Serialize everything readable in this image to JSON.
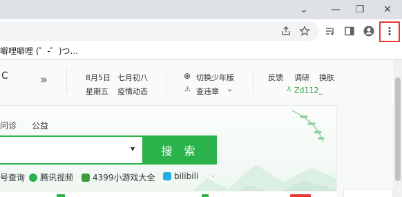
{
  "window": {
    "controls": {
      "chevron": "⌄",
      "minimize": "—",
      "restore": "❐",
      "close": "✕"
    }
  },
  "toolbar": {
    "icons": [
      "share-icon",
      "star-icon",
      "reading-list-icon",
      "side-panel-icon",
      "profile-icon",
      "kebab-menu-icon"
    ],
    "highlight_color": "#e53935"
  },
  "bookmarks": {
    "item": "噼哩噼哩 (゜-゜)つ..."
  },
  "header": {
    "partial_left": "C",
    "chevrons": "»",
    "date": "8月5日",
    "weekday": "星期五",
    "lunar": "七月初八",
    "epidemic": "疫情动态",
    "youth_mode": "切换少年版",
    "violation": "查违章",
    "feedback": "反馈",
    "survey": "调研",
    "skin": "换肤",
    "username": "Zd112_"
  },
  "search": {
    "tabs": [
      "问诊",
      "公益"
    ],
    "button_label": "搜 索",
    "accent": "#2ab34a",
    "quick_links": [
      {
        "label": "号查询",
        "color": "#5b8def"
      },
      {
        "label": "腾讯视频",
        "color": "#2ab34a"
      },
      {
        "label": "4399小游戏大全",
        "color": "#3c9b3c"
      },
      {
        "label": "bilibili",
        "color": "#23ade5"
      }
    ]
  }
}
